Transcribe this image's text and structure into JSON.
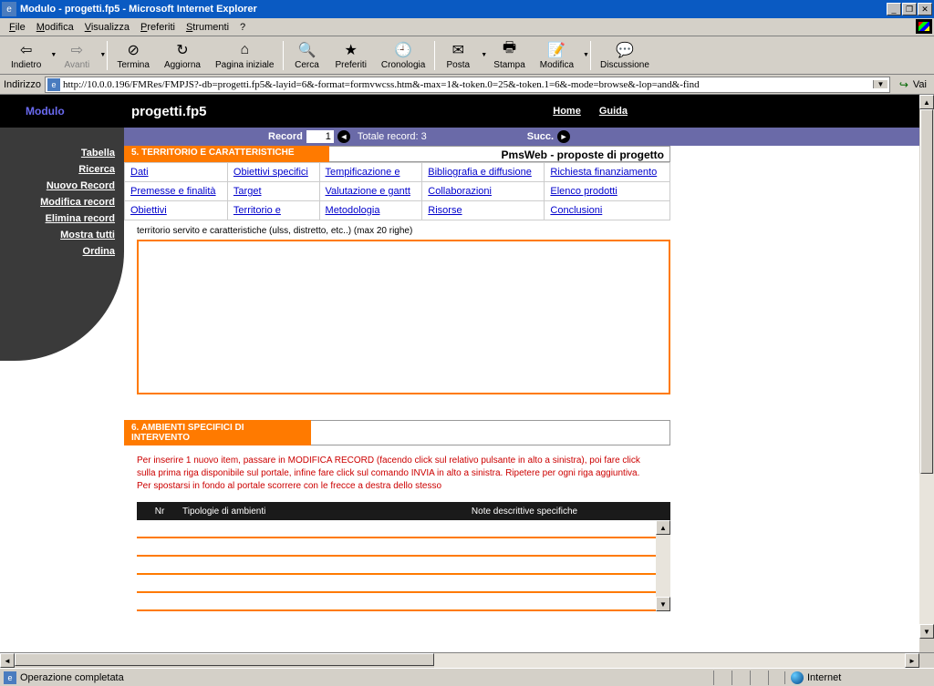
{
  "window": {
    "title": "Modulo - progetti.fp5 - Microsoft Internet Explorer"
  },
  "menubar": {
    "file": "File",
    "modifica": "Modifica",
    "visualizza": "Visualizza",
    "preferiti": "Preferiti",
    "strumenti": "Strumenti",
    "help": "?"
  },
  "toolbar": {
    "back": "Indietro",
    "forward": "Avanti",
    "stop": "Termina",
    "refresh": "Aggiorna",
    "home": "Pagina iniziale",
    "search": "Cerca",
    "favorites": "Preferiti",
    "history": "Cronologia",
    "mail": "Posta",
    "print": "Stampa",
    "edit": "Modifica",
    "discuss": "Discussione"
  },
  "addressbar": {
    "label": "Indirizzo",
    "url": "http://10.0.0.196/FMRes/FMPJS?-db=progetti.fp5&-layid=6&-format=formvwcss.htm&-max=1&-token.0=25&-token.1=6&-mode=browse&-lop=and&-find",
    "go": "Vai"
  },
  "page": {
    "modulo": "Modulo",
    "title": "progetti.fp5",
    "home": "Home",
    "guide": "Guida"
  },
  "sidebar": {
    "items": [
      "Tabella",
      "Ricerca",
      "Nuovo Record",
      "Modifica record",
      "Elimina record",
      "Mostra tutti",
      "Ordina"
    ]
  },
  "recordbar": {
    "label": "Record",
    "value": "1",
    "total": "Totale record: 3",
    "next": "Succ."
  },
  "section5": {
    "header": "5. TERRITORIO E CARATTERISTICHE",
    "breadcrumb": "PmsWeb - proposte di progetto",
    "links": [
      [
        "Dati",
        "Obiettivi specifici",
        "Tempificazione e",
        "Bibliografia e diffusione",
        "Richiesta finanziamento"
      ],
      [
        "Premesse e finalità",
        "Target",
        "Valutazione e gantt",
        "Collaborazioni",
        "Elenco prodotti"
      ],
      [
        "Obiettivi",
        "Territorio e",
        "Metodologia",
        "Risorse",
        "Conclusioni"
      ]
    ],
    "desc_label": "territorio servito e caratteristiche (ulss, distretto, etc..) (max 20 righe)"
  },
  "section6": {
    "header": "6. AMBIENTI SPECIFICI DI INTERVENTO",
    "note": "Per inserire 1 nuovo item, passare in MODIFICA RECORD (facendo click sul relativo pulsante in alto a sinistra), poi fare click sulla prima riga disponibile sul portale, infine fare click sul comando INVIA in alto a sinistra. Ripetere per ogni riga aggiuntiva. Per spostarsi in fondo al portale scorrere con le frecce a destra dello stesso",
    "col_nr": "Nr",
    "col_tip": "Tipologie di ambienti",
    "col_note": "Note descrittive specifiche"
  },
  "statusbar": {
    "text": "Operazione completata",
    "zone": "Internet"
  }
}
